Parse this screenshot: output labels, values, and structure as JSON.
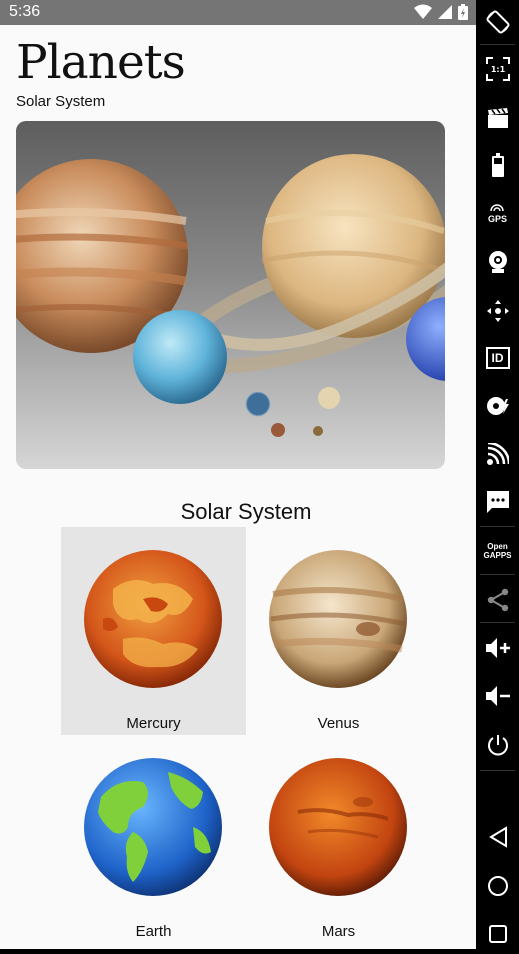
{
  "status_bar": {
    "time": "5:36",
    "icons": [
      "wifi-icon",
      "signal-icon",
      "battery-icon"
    ]
  },
  "app": {
    "title": "Planets",
    "subtitle": "Solar System",
    "hero_image": "solar-system-planets-image",
    "section_title": "Solar System",
    "planets": [
      {
        "name": "Mercury",
        "selected": true
      },
      {
        "name": "Venus",
        "selected": false
      },
      {
        "name": "Earth",
        "selected": false
      },
      {
        "name": "Mars",
        "selected": false
      }
    ]
  },
  "toolbar": {
    "items": [
      "rotate-icon",
      "fullscreen-icon",
      "screencast-icon",
      "battery-icon",
      "gps-icon",
      "webcam-icon",
      "move-icon",
      "id-icon",
      "disk-icon",
      "cast-icon",
      "sms-icon",
      "opengapps-icon",
      "share-icon",
      "volume-up-icon",
      "volume-down-icon",
      "power-icon",
      "back-icon",
      "home-icon",
      "recents-icon"
    ],
    "scale_label": "1:1",
    "gps_label": "GPS",
    "id_label": "ID",
    "opengapps_label": "Open\nGAPPS"
  },
  "colors": {
    "status_bar": "#757575",
    "background": "#fafafa",
    "selected_item": "#e5e5e5",
    "toolbar": "#000000"
  }
}
